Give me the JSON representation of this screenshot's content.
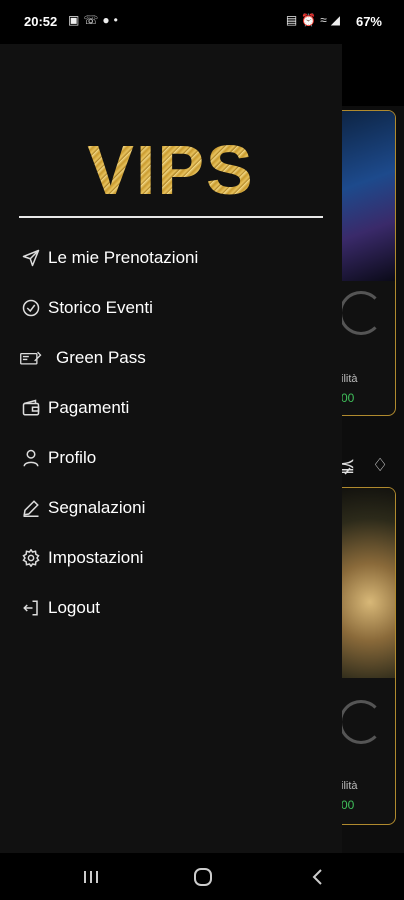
{
  "status_bar": {
    "time": "20:52",
    "battery": "67%",
    "left_icons": [
      "gallery-icon",
      "whatsapp-icon",
      "facebook-icon",
      "dot-icon"
    ],
    "right_icons": [
      "sim-icon",
      "alarm-icon",
      "wifi-icon",
      "signal-icon"
    ]
  },
  "drawer": {
    "logo_text": "VIPS",
    "menu": [
      {
        "label": "Le mie Prenotazioni",
        "icon": "send-icon"
      },
      {
        "label": "Storico Eventi",
        "icon": "check-circle-icon"
      },
      {
        "label": "Green Pass",
        "icon": "ticket-icon"
      },
      {
        "label": "Pagamenti",
        "icon": "wallet-icon"
      },
      {
        "label": "Profilo",
        "icon": "user-icon"
      },
      {
        "label": "Segnalazioni",
        "icon": "pencil-icon"
      },
      {
        "label": "Impostazioni",
        "icon": "gear-icon"
      },
      {
        "label": "Logout",
        "icon": "logout-icon"
      }
    ]
  },
  "background": {
    "card1_text": "ilità",
    "card1_price": "00",
    "card2_text": "ilità",
    "card2_price": "00"
  },
  "colors": {
    "drawer_bg": "#111111",
    "gold": "#d9b24a",
    "price_green": "#3fbf5a",
    "card_border": "#b08a2e"
  }
}
